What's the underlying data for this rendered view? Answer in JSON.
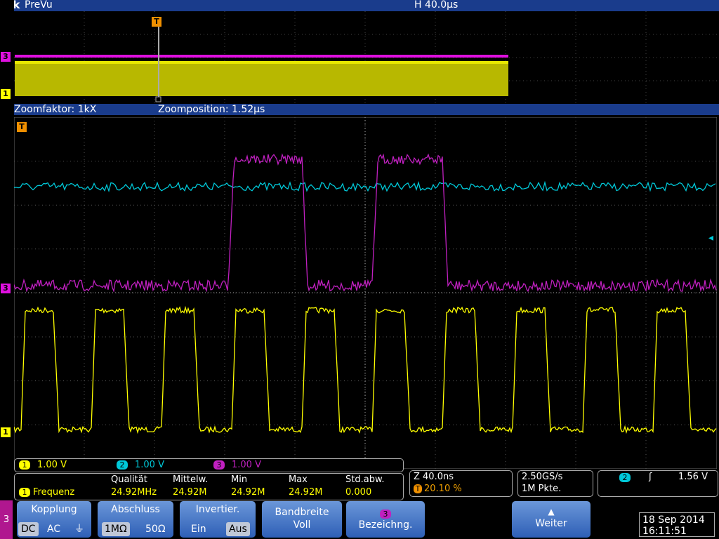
{
  "header": {
    "brand": "Tek",
    "mode": "PreVu",
    "horizontal_scale": "H 40.0µs"
  },
  "zoom": {
    "factor_label": "Zoomfaktor: 1kX",
    "position_label": "Zoomposition: 1.52µs"
  },
  "channels": [
    {
      "id": "1",
      "scale": "1.00 V",
      "color": "#ffff00"
    },
    {
      "id": "2",
      "scale": "1.00 V",
      "color": "#00c8d8"
    },
    {
      "id": "3",
      "scale": "1.00 V",
      "color": "#c020c0"
    }
  ],
  "markers": {
    "trigger": "T",
    "ch1": "1",
    "ch3": "3"
  },
  "measurement": {
    "channel": "1",
    "name": "Frequenz",
    "headers": {
      "quality": "Qualität",
      "mean": "Mittelw.",
      "min": "Min",
      "max": "Max",
      "std": "Std.abw."
    },
    "values": {
      "quality": "24.92MHz",
      "mean": "24.92M",
      "min": "24.92M",
      "max": "24.92M",
      "std": "0.000"
    }
  },
  "timebase": {
    "zoom_scale": "Z 40.0ns",
    "trigger_marker": "T",
    "trigger_pos": "20.10 %"
  },
  "acquisition": {
    "sample_rate": "2.50GS/s",
    "record_length": "1M Pkte."
  },
  "trigger": {
    "source": "2",
    "slope_symbol": "ʃ",
    "level": "1.56 V"
  },
  "menu": {
    "channel_tab": "3",
    "coupling": {
      "title": "Kopplung",
      "options": [
        "DC",
        "AC",
        "⏚"
      ],
      "selected": "DC"
    },
    "termination": {
      "title": "Abschluss",
      "options": [
        "1MΩ",
        "50Ω"
      ],
      "selected": "1MΩ"
    },
    "invert": {
      "title": "Invertier.",
      "options": [
        "Ein",
        "Aus"
      ],
      "selected": "Aus"
    },
    "bandwidth": {
      "title": "Bandbreite",
      "value": "Voll"
    },
    "label": {
      "chip": "3",
      "title": "Bezeichng."
    },
    "next": {
      "title": "Weiter"
    }
  },
  "datetime": {
    "date": "18 Sep  2014",
    "time": "16:11:51"
  }
}
